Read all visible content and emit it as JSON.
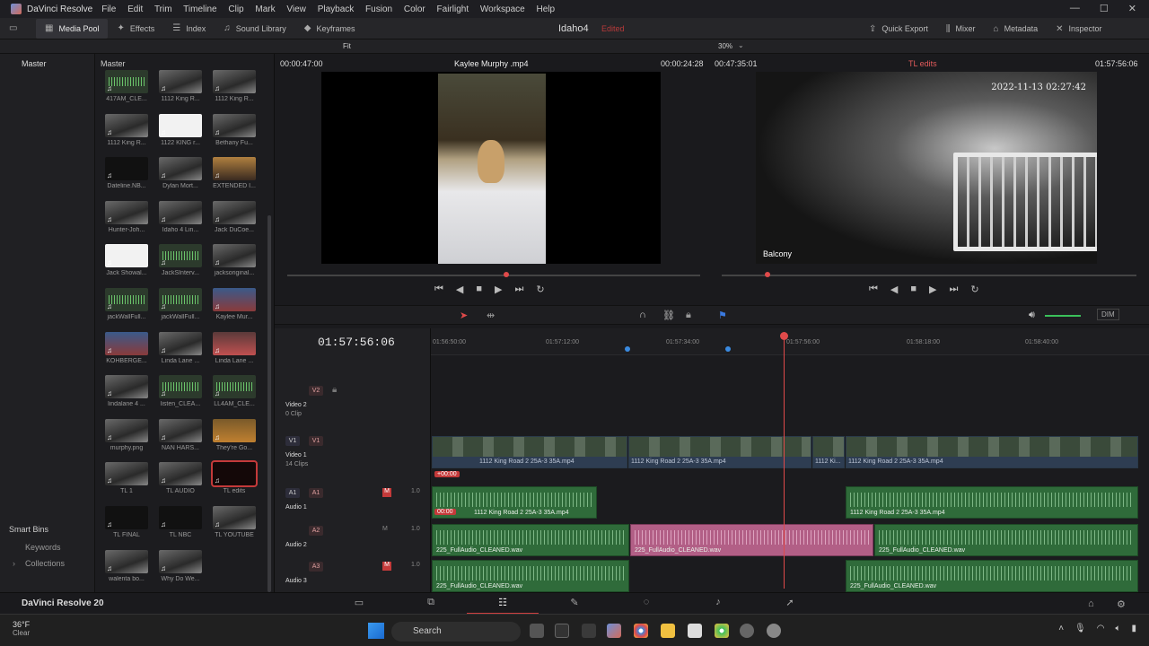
{
  "titlebar": {
    "app": "DaVinci Resolve",
    "menu": [
      "File",
      "Edit",
      "Trim",
      "Timeline",
      "Clip",
      "Mark",
      "View",
      "Playback",
      "Fusion",
      "Color",
      "Fairlight",
      "Workspace",
      "Help"
    ]
  },
  "toolbar": {
    "media_pool": "Media Pool",
    "effects": "Effects",
    "index": "Index",
    "sound_library": "Sound Library",
    "keyframes": "Keyframes",
    "project": "Idaho4",
    "edited": "Edited",
    "quick_export": "Quick Export",
    "mixer": "Mixer",
    "metadata": "Metadata",
    "inspector": "Inspector"
  },
  "subbar": {
    "fit": "Fit",
    "zoom": "30%"
  },
  "left": {
    "master": "Master",
    "smart_bins": "Smart Bins",
    "keywords": "Keywords",
    "collections": "Collections"
  },
  "pool": {
    "header": "Master",
    "clips": [
      {
        "label": "417AM_CLE...",
        "kind": "aud"
      },
      {
        "label": "1112 King R...",
        "kind": "img"
      },
      {
        "label": "1112 King R...",
        "kind": "img"
      },
      {
        "label": "1112 King R...",
        "kind": "img"
      },
      {
        "label": "1122 KING r...",
        "kind": "white"
      },
      {
        "label": "Bethany Fu...",
        "kind": "img"
      },
      {
        "label": "Dateline.NB...",
        "kind": "dark"
      },
      {
        "label": "Dylan Mort...",
        "kind": "img"
      },
      {
        "label": "EXTENDED I...",
        "kind": "warm"
      },
      {
        "label": "Hunter-Joh...",
        "kind": "img"
      },
      {
        "label": "Idaho 4 Lin...",
        "kind": "img"
      },
      {
        "label": "Jack DuCoe...",
        "kind": "img"
      },
      {
        "label": "Jack Showal...",
        "kind": "white"
      },
      {
        "label": "JackSInterv...",
        "kind": "aud"
      },
      {
        "label": "jacksoriginal...",
        "kind": "img"
      },
      {
        "label": "jackWallFull...",
        "kind": "aud"
      },
      {
        "label": "jackWallFull...",
        "kind": "aud"
      },
      {
        "label": "Kaylee Mur...",
        "kind": "person"
      },
      {
        "label": "KOHBERGE...",
        "kind": "person"
      },
      {
        "label": "Linda Lane ...",
        "kind": "img"
      },
      {
        "label": "Linda Lane ...",
        "kind": "pink"
      },
      {
        "label": "lindalane 4 ...",
        "kind": "img"
      },
      {
        "label": "listen_CLEA...",
        "kind": "aud"
      },
      {
        "label": "LL4AM_CLE...",
        "kind": "aud"
      },
      {
        "label": "murphy.png",
        "kind": "img"
      },
      {
        "label": "NAN HARS...",
        "kind": "img"
      },
      {
        "label": "They're Go...",
        "kind": "tv"
      },
      {
        "label": "TL 1",
        "kind": "img"
      },
      {
        "label": "TL AUDIO",
        "kind": "img"
      },
      {
        "label": "TL edits",
        "kind": "red"
      },
      {
        "label": "TL FINAL",
        "kind": "dark"
      },
      {
        "label": "TL NBC",
        "kind": "dark"
      },
      {
        "label": "TL YOUTUBE",
        "kind": "img"
      },
      {
        "label": "walenta bo...",
        "kind": "img"
      },
      {
        "label": "Why Do We...",
        "kind": "img"
      }
    ]
  },
  "source": {
    "tc_left": "00:00:47:00",
    "name": "Kaylee Murphy .mp4",
    "tc_right": "00:00:24:28"
  },
  "record": {
    "tc_left": "00:47:35:01",
    "name": "TL edits",
    "tc_right": "01:57:56:06",
    "overlay_date": "2022-11-13 02:27:42",
    "overlay_label": "Balcony"
  },
  "timeline": {
    "timecode": "01:57:56:06",
    "ruler": [
      "01:56:50:00",
      "01:57:12:00",
      "01:57:34:00",
      "01:57:56:00",
      "01:58:18:00",
      "01:58:40:00"
    ],
    "v2": {
      "tag": "V2",
      "name": "Video 2",
      "sub": "0 Clip"
    },
    "v1": {
      "tag": "V1",
      "tag2": "V1",
      "name": "Video 1",
      "sub": "14 Clips",
      "clip": "1112 King Road 2 25A-3 35A.mp4",
      "clip_short": "1112 Ki...",
      "tc": "+00:00"
    },
    "a1": {
      "tag": "A1",
      "tag2": "A1",
      "name": "Audio 1",
      "vol": "1.0",
      "clip": "1112 King Road 2 25A-3 35A.mp4",
      "tc": "00:00"
    },
    "a2": {
      "tag": "A2",
      "name": "Audio 2",
      "vol": "1.0",
      "clip": "225_FullAudio_CLEANED.wav"
    },
    "a3": {
      "tag": "A3",
      "name": "Audio 3",
      "vol": "1.0",
      "clip": "225_FullAudio_CLEANED.wav"
    }
  },
  "pagebar": {
    "brand": "DaVinci Resolve 20"
  },
  "taskbar": {
    "temp": "36°F",
    "cond": "Clear",
    "search": "Search"
  },
  "colors": {
    "accent": "#c43a3a",
    "audio": "#2f6b3a",
    "selected": "#b25f86"
  }
}
